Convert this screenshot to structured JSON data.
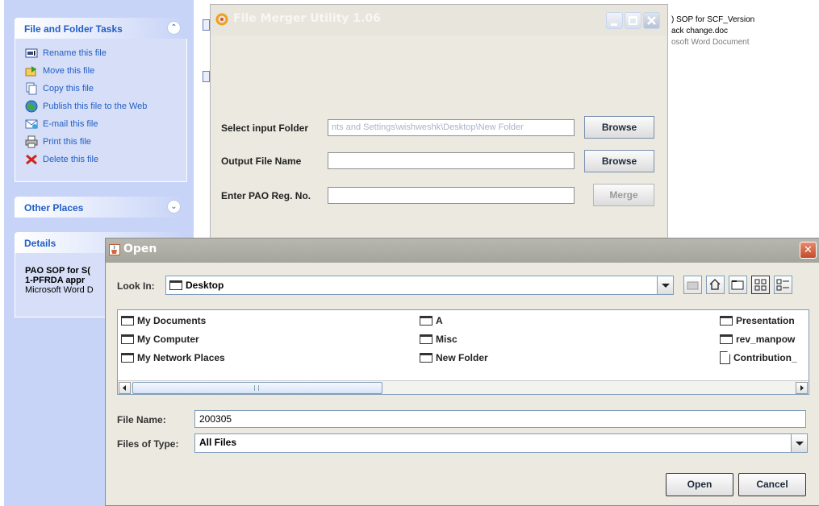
{
  "taskpane": {
    "file_folder_tasks": {
      "title": "File and Folder Tasks",
      "items": [
        {
          "label": "Rename this file",
          "icon": "rename-icon"
        },
        {
          "label": "Move this file",
          "icon": "move-icon"
        },
        {
          "label": "Copy this file",
          "icon": "copy-icon"
        },
        {
          "label": "Publish this file to the Web",
          "icon": "globe-icon"
        },
        {
          "label": "E-mail this file",
          "icon": "email-icon"
        },
        {
          "label": "Print this file",
          "icon": "printer-icon"
        },
        {
          "label": "Delete this file",
          "icon": "delete-icon"
        }
      ]
    },
    "other_places": {
      "title": "Other Places"
    },
    "details": {
      "title": "Details",
      "line1": "PAO SOP for S(",
      "line2": "1-PFRDA appr",
      "line3": "Microsoft Word D"
    }
  },
  "background_file": {
    "line1": ") SOP for SCF_Version",
    "line2": "ack change.doc",
    "line3": "osoft Word Document"
  },
  "merger": {
    "title": "File Merger Utility 1.06",
    "input_folder_label": "Select input Folder",
    "input_folder_value": "nts and Settings\\wishweshk\\Desktop\\New Folder",
    "output_label": "Output File Name",
    "output_value": "",
    "pao_label": "Enter PAO Reg. No.",
    "pao_value": "",
    "browse1_label": "Browse",
    "browse2_label": "Browse",
    "merge_label": "Merge"
  },
  "open_dialog": {
    "title": "Open",
    "look_in_label": "Look In:",
    "look_in_value": "Desktop",
    "files": {
      "col1": [
        "My Documents",
        "My Computer",
        "My Network Places"
      ],
      "col2": [
        "A",
        "Misc",
        "New Folder"
      ],
      "col3": [
        "Presentation",
        "rev_manpow",
        "Contribution_"
      ]
    },
    "file_name_label": "File Name:",
    "file_name_value": "200305",
    "files_of_type_label": "Files of Type:",
    "files_of_type_value": "All Files",
    "open_button": "Open",
    "cancel_button": "Cancel"
  },
  "colors": {
    "task_link": "#215dc6",
    "close_red": "#c24a2a"
  }
}
